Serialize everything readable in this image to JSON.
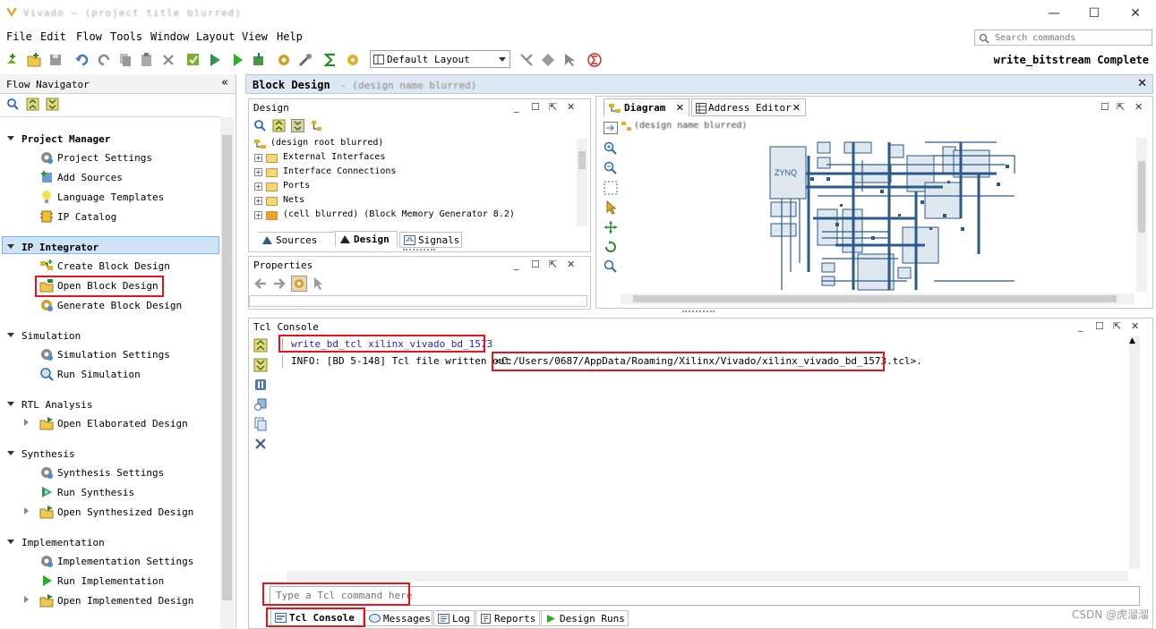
{
  "window": {
    "title": "Vivado — (project title blurred)",
    "min": "—",
    "max": "☐",
    "close": "✕"
  },
  "menu": [
    "File",
    "Edit",
    "Flow",
    "Tools",
    "Window",
    "Layout",
    "View",
    "Help"
  ],
  "search": {
    "placeholder": "Search commands"
  },
  "toolbar": {
    "layout_value": "Default Layout",
    "status": "write_bitstream Complete"
  },
  "flow_nav": {
    "title": "Flow Navigator",
    "sections": {
      "project_manager": "Project Manager",
      "ip_integrator": "IP Integrator",
      "simulation": "Simulation",
      "rtl_analysis": "RTL Analysis",
      "synthesis": "Synthesis",
      "implementation": "Implementation"
    },
    "items": {
      "project_settings": "Project Settings",
      "add_sources": "Add Sources",
      "language_templates": "Language Templates",
      "ip_catalog": "IP Catalog",
      "create_block_design": "Create Block Design",
      "open_block_design": "Open Block Design",
      "generate_block_design": "Generate Block Design",
      "simulation_settings": "Simulation Settings",
      "run_simulation": "Run Simulation",
      "open_elaborated_design": "Open Elaborated Design",
      "synthesis_settings": "Synthesis Settings",
      "run_synthesis": "Run Synthesis",
      "open_synthesized_design": "Open Synthesized Design",
      "implementation_settings": "Implementation Settings",
      "run_implementation": "Run Implementation",
      "open_implemented_design": "Open Implemented Design"
    }
  },
  "block_design": {
    "title": "Block Design",
    "subtitle": "- (design name blurred)",
    "design_panel": {
      "title": "Design",
      "tree": [
        "(design root blurred)",
        "External Interfaces",
        "Interface Connections",
        "Ports",
        "Nets",
        "(cell blurred) (Block Memory Generator 8.2)"
      ],
      "tabs": [
        "Sources",
        "Design",
        "Signals"
      ]
    },
    "properties_panel": {
      "title": "Properties"
    },
    "diagram_tabs": [
      "Diagram",
      "Address Editor"
    ],
    "diagram_breadcrumb": "(design name blurred)",
    "zynq_label": "ZYNQ"
  },
  "tcl_console": {
    "title": "Tcl Console",
    "lines": [
      "write_bd_tcl  xilinx_vivado_bd_1573",
      "INFO: [BD 5-148] Tcl file written out "
    ],
    "path": "<C:/Users/0687/AppData/Roaming/Xilinx/Vivado/xilinx_vivado_bd_1573.tcl>.",
    "input_placeholder": "Type a Tcl command here",
    "tabs": [
      "Tcl Console",
      "Messages",
      "Log",
      "Reports",
      "Design Runs"
    ]
  },
  "watermark": "CSDN @虎溜溜",
  "colors": {
    "highlight": "#e8141b",
    "selected_bg": "#cfe3f8",
    "accent_blue": "#2b5a8a"
  }
}
